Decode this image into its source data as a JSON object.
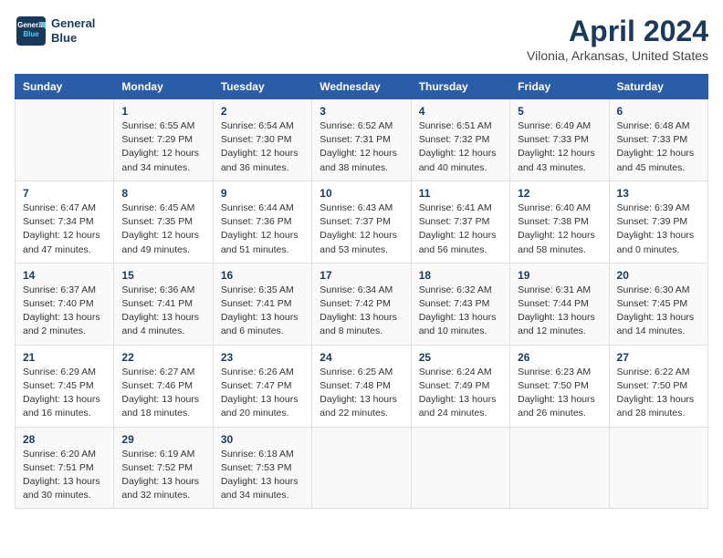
{
  "header": {
    "logo_line1": "General",
    "logo_line2": "Blue",
    "title": "April 2024",
    "subtitle": "Vilonia, Arkansas, United States"
  },
  "days_of_week": [
    "Sunday",
    "Monday",
    "Tuesday",
    "Wednesday",
    "Thursday",
    "Friday",
    "Saturday"
  ],
  "weeks": [
    [
      {
        "day": "",
        "info": ""
      },
      {
        "day": "1",
        "info": "Sunrise: 6:55 AM\nSunset: 7:29 PM\nDaylight: 12 hours\nand 34 minutes."
      },
      {
        "day": "2",
        "info": "Sunrise: 6:54 AM\nSunset: 7:30 PM\nDaylight: 12 hours\nand 36 minutes."
      },
      {
        "day": "3",
        "info": "Sunrise: 6:52 AM\nSunset: 7:31 PM\nDaylight: 12 hours\nand 38 minutes."
      },
      {
        "day": "4",
        "info": "Sunrise: 6:51 AM\nSunset: 7:32 PM\nDaylight: 12 hours\nand 40 minutes."
      },
      {
        "day": "5",
        "info": "Sunrise: 6:49 AM\nSunset: 7:33 PM\nDaylight: 12 hours\nand 43 minutes."
      },
      {
        "day": "6",
        "info": "Sunrise: 6:48 AM\nSunset: 7:33 PM\nDaylight: 12 hours\nand 45 minutes."
      }
    ],
    [
      {
        "day": "7",
        "info": "Sunrise: 6:47 AM\nSunset: 7:34 PM\nDaylight: 12 hours\nand 47 minutes."
      },
      {
        "day": "8",
        "info": "Sunrise: 6:45 AM\nSunset: 7:35 PM\nDaylight: 12 hours\nand 49 minutes."
      },
      {
        "day": "9",
        "info": "Sunrise: 6:44 AM\nSunset: 7:36 PM\nDaylight: 12 hours\nand 51 minutes."
      },
      {
        "day": "10",
        "info": "Sunrise: 6:43 AM\nSunset: 7:37 PM\nDaylight: 12 hours\nand 53 minutes."
      },
      {
        "day": "11",
        "info": "Sunrise: 6:41 AM\nSunset: 7:37 PM\nDaylight: 12 hours\nand 56 minutes."
      },
      {
        "day": "12",
        "info": "Sunrise: 6:40 AM\nSunset: 7:38 PM\nDaylight: 12 hours\nand 58 minutes."
      },
      {
        "day": "13",
        "info": "Sunrise: 6:39 AM\nSunset: 7:39 PM\nDaylight: 13 hours\nand 0 minutes."
      }
    ],
    [
      {
        "day": "14",
        "info": "Sunrise: 6:37 AM\nSunset: 7:40 PM\nDaylight: 13 hours\nand 2 minutes."
      },
      {
        "day": "15",
        "info": "Sunrise: 6:36 AM\nSunset: 7:41 PM\nDaylight: 13 hours\nand 4 minutes."
      },
      {
        "day": "16",
        "info": "Sunrise: 6:35 AM\nSunset: 7:41 PM\nDaylight: 13 hours\nand 6 minutes."
      },
      {
        "day": "17",
        "info": "Sunrise: 6:34 AM\nSunset: 7:42 PM\nDaylight: 13 hours\nand 8 minutes."
      },
      {
        "day": "18",
        "info": "Sunrise: 6:32 AM\nSunset: 7:43 PM\nDaylight: 13 hours\nand 10 minutes."
      },
      {
        "day": "19",
        "info": "Sunrise: 6:31 AM\nSunset: 7:44 PM\nDaylight: 13 hours\nand 12 minutes."
      },
      {
        "day": "20",
        "info": "Sunrise: 6:30 AM\nSunset: 7:45 PM\nDaylight: 13 hours\nand 14 minutes."
      }
    ],
    [
      {
        "day": "21",
        "info": "Sunrise: 6:29 AM\nSunset: 7:45 PM\nDaylight: 13 hours\nand 16 minutes."
      },
      {
        "day": "22",
        "info": "Sunrise: 6:27 AM\nSunset: 7:46 PM\nDaylight: 13 hours\nand 18 minutes."
      },
      {
        "day": "23",
        "info": "Sunrise: 6:26 AM\nSunset: 7:47 PM\nDaylight: 13 hours\nand 20 minutes."
      },
      {
        "day": "24",
        "info": "Sunrise: 6:25 AM\nSunset: 7:48 PM\nDaylight: 13 hours\nand 22 minutes."
      },
      {
        "day": "25",
        "info": "Sunrise: 6:24 AM\nSunset: 7:49 PM\nDaylight: 13 hours\nand 24 minutes."
      },
      {
        "day": "26",
        "info": "Sunrise: 6:23 AM\nSunset: 7:50 PM\nDaylight: 13 hours\nand 26 minutes."
      },
      {
        "day": "27",
        "info": "Sunrise: 6:22 AM\nSunset: 7:50 PM\nDaylight: 13 hours\nand 28 minutes."
      }
    ],
    [
      {
        "day": "28",
        "info": "Sunrise: 6:20 AM\nSunset: 7:51 PM\nDaylight: 13 hours\nand 30 minutes."
      },
      {
        "day": "29",
        "info": "Sunrise: 6:19 AM\nSunset: 7:52 PM\nDaylight: 13 hours\nand 32 minutes."
      },
      {
        "day": "30",
        "info": "Sunrise: 6:18 AM\nSunset: 7:53 PM\nDaylight: 13 hours\nand 34 minutes."
      },
      {
        "day": "",
        "info": ""
      },
      {
        "day": "",
        "info": ""
      },
      {
        "day": "",
        "info": ""
      },
      {
        "day": "",
        "info": ""
      }
    ]
  ]
}
